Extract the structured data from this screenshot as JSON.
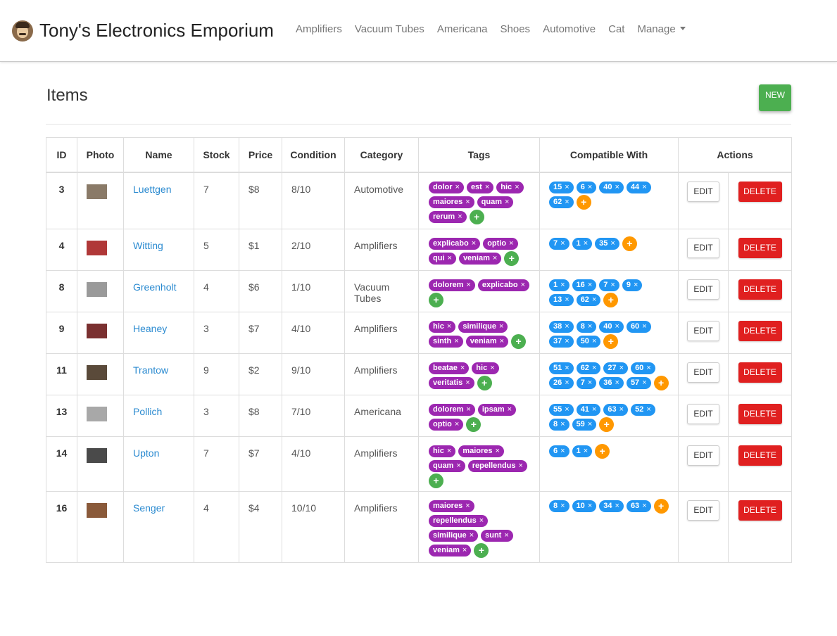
{
  "nav": {
    "brand": "Tony's Electronics Emporium",
    "links": [
      "Amplifiers",
      "Vacuum Tubes",
      "Americana",
      "Shoes",
      "Automotive",
      "Cat"
    ],
    "manage": "Manage"
  },
  "page": {
    "title": "Items",
    "new_label": "NEW"
  },
  "table": {
    "headers": [
      "ID",
      "Photo",
      "Name",
      "Stock",
      "Price",
      "Condition",
      "Category",
      "Tags",
      "Compatible With",
      "Actions"
    ],
    "edit_label": "EDIT",
    "delete_label": "DELETE",
    "add_symbol": "+",
    "remove_symbol": "×",
    "rows": [
      {
        "id": "3",
        "name": "Luettgen",
        "stock": "7",
        "price": "$8",
        "condition": "8/10",
        "category": "Automotive",
        "tags": [
          "dolor",
          "est",
          "hic",
          "maiores",
          "quam",
          "rerum"
        ],
        "compatible": [
          "15",
          "6",
          "40",
          "44",
          "62"
        ],
        "photo_color": "#8a7a68"
      },
      {
        "id": "4",
        "name": "Witting",
        "stock": "5",
        "price": "$1",
        "condition": "2/10",
        "category": "Amplifiers",
        "tags": [
          "explicabo",
          "optio",
          "qui",
          "veniam"
        ],
        "compatible": [
          "7",
          "1",
          "35"
        ],
        "photo_color": "#b03838"
      },
      {
        "id": "8",
        "name": "Greenholt",
        "stock": "4",
        "price": "$6",
        "condition": "1/10",
        "category": "Vacuum Tubes",
        "tags": [
          "dolorem",
          "explicabo"
        ],
        "compatible": [
          "1",
          "16",
          "7",
          "9",
          "13",
          "62"
        ],
        "photo_color": "#9a9a9a"
      },
      {
        "id": "9",
        "name": "Heaney",
        "stock": "3",
        "price": "$7",
        "condition": "4/10",
        "category": "Amplifiers",
        "tags": [
          "hic",
          "similique",
          "sinth",
          "veniam"
        ],
        "compatible": [
          "38",
          "8",
          "40",
          "60",
          "37",
          "50"
        ],
        "photo_color": "#7a3030"
      },
      {
        "id": "11",
        "name": "Trantow",
        "stock": "9",
        "price": "$2",
        "condition": "9/10",
        "category": "Amplifiers",
        "tags": [
          "beatae",
          "hic",
          "veritatis"
        ],
        "compatible": [
          "51",
          "62",
          "27",
          "60",
          "26",
          "7",
          "36",
          "57"
        ],
        "photo_color": "#5a4a3a"
      },
      {
        "id": "13",
        "name": "Pollich",
        "stock": "3",
        "price": "$8",
        "condition": "7/10",
        "category": "Americana",
        "tags": [
          "dolorem",
          "ipsam",
          "optio"
        ],
        "compatible": [
          "55",
          "41",
          "63",
          "52",
          "8",
          "59"
        ],
        "photo_color": "#a8a8a8"
      },
      {
        "id": "14",
        "name": "Upton",
        "stock": "7",
        "price": "$7",
        "condition": "4/10",
        "category": "Amplifiers",
        "tags": [
          "hic",
          "maiores",
          "quam",
          "repellendus"
        ],
        "compatible": [
          "6",
          "1"
        ],
        "photo_color": "#4a4a4a"
      },
      {
        "id": "16",
        "name": "Senger",
        "stock": "4",
        "price": "$4",
        "condition": "10/10",
        "category": "Amplifiers",
        "tags": [
          "maiores",
          "repellendus",
          "similique",
          "sunt",
          "veniam"
        ],
        "compatible": [
          "8",
          "10",
          "34",
          "63"
        ],
        "photo_color": "#8a5a3a"
      }
    ]
  }
}
